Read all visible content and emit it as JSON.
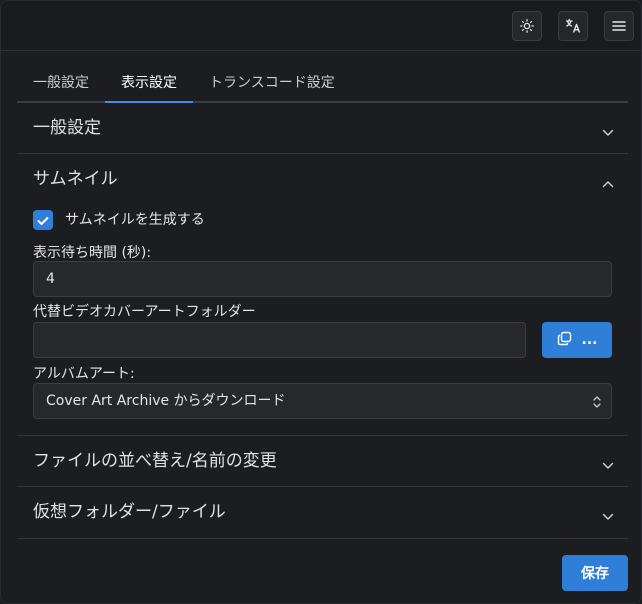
{
  "topbar": {
    "icons": [
      "sun-icon",
      "translate-icon",
      "menu-icon"
    ]
  },
  "tabs": [
    {
      "label": "一般設定",
      "active": false
    },
    {
      "label": "表示設定",
      "active": true
    },
    {
      "label": "トランスコード設定",
      "active": false
    }
  ],
  "sections": {
    "general": {
      "title": "一般設定",
      "expanded": false
    },
    "thumbnail": {
      "title": "サムネイル",
      "expanded": true,
      "generate_checkbox": {
        "label": "サムネイルを生成する",
        "checked": true
      },
      "wait_time": {
        "label": "表示待ち時間 (秒):",
        "value": "4"
      },
      "cover_folder": {
        "label": "代替ビデオカバーアートフォルダー",
        "value": "",
        "browse_label": "..."
      },
      "album_art": {
        "label": "アルバムアート:",
        "selected": "Cover Art Archive からダウンロード"
      }
    },
    "sort_rename": {
      "title": "ファイルの並べ替え/名前の変更",
      "expanded": false
    },
    "virtual": {
      "title": "仮想フォルダー/ファイル",
      "expanded": false
    }
  },
  "footer": {
    "save_label": "保存"
  },
  "colors": {
    "accent": "#2f7fd8",
    "background": "#1c1d21"
  }
}
